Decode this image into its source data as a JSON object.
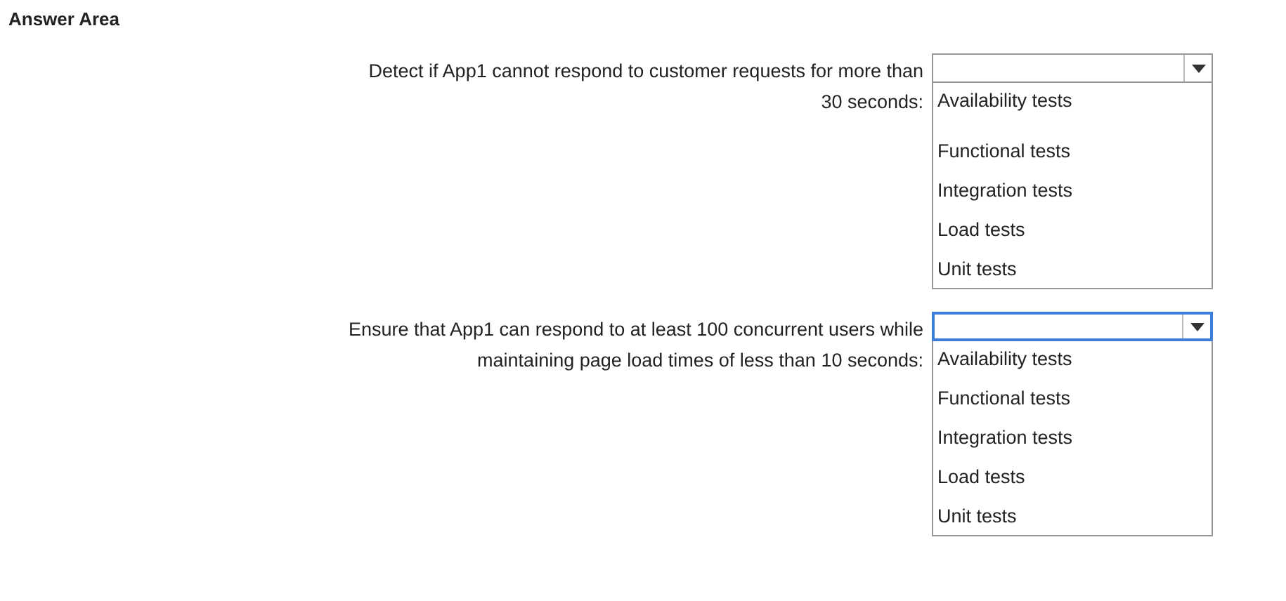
{
  "title": "Answer Area",
  "questions": [
    {
      "lines": [
        "Detect if App1 cannot respond to customer requests for more than",
        "30 seconds:"
      ],
      "focused": false,
      "options": [
        "Availability tests",
        "Functional tests",
        "Integration tests",
        "Load tests",
        "Unit tests"
      ]
    },
    {
      "lines": [
        "Ensure that App1 can respond to at least 100 concurrent users while",
        "maintaining page load times of less than 10 seconds:"
      ],
      "focused": true,
      "options": [
        "Availability tests",
        "Functional tests",
        "Integration tests",
        "Load tests",
        "Unit tests"
      ]
    }
  ]
}
